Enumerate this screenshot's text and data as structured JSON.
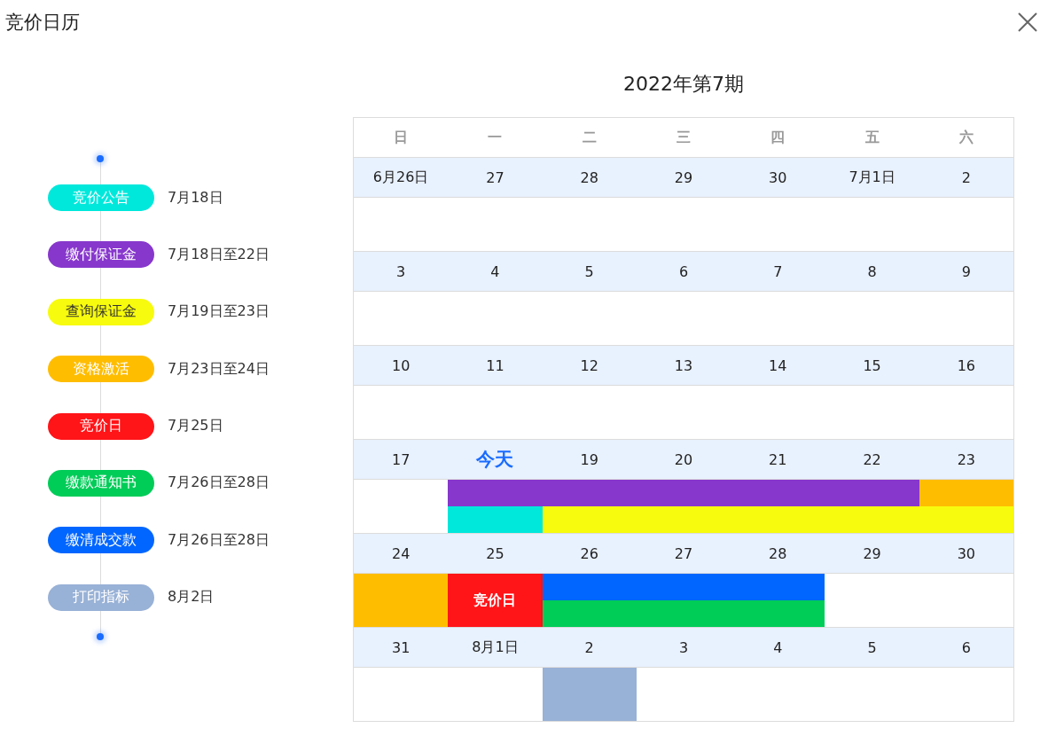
{
  "window": {
    "title": "竞价日历"
  },
  "legend": [
    {
      "label": "竞价公告",
      "color": "#00e8dc",
      "dates": "7月18日"
    },
    {
      "label": "缴付保证金",
      "color": "#8737cc",
      "dates": "7月18日至22日"
    },
    {
      "label": "查询保证金",
      "color": "#f7fb0d",
      "dates": "7月19日至23日"
    },
    {
      "label": "资格激活",
      "color": "#ffbd00",
      "dates": "7月23日至24日"
    },
    {
      "label": "竞价日",
      "color": "#ff1418",
      "dates": "7月25日"
    },
    {
      "label": "缴款通知书",
      "color": "#00cc58",
      "dates": "7月26日至28日"
    },
    {
      "label": "缴清成交款",
      "color": "#0066ff",
      "dates": "7月26日至28日"
    },
    {
      "label": "打印指标",
      "color": "#98b1d6",
      "dates": "8月2日"
    }
  ],
  "calendar": {
    "title": "2022年第7期",
    "weekdays": [
      "日",
      "一",
      "二",
      "三",
      "四",
      "五",
      "六"
    ],
    "weeks": [
      {
        "days": [
          {
            "label": "6月26日",
            "today": false
          },
          {
            "label": "27",
            "today": false
          },
          {
            "label": "28",
            "today": false
          },
          {
            "label": "29",
            "today": false
          },
          {
            "label": "30",
            "today": false
          },
          {
            "label": "7月1日",
            "today": false
          },
          {
            "label": "2",
            "today": false
          }
        ]
      },
      {
        "days": [
          {
            "label": "3",
            "today": false
          },
          {
            "label": "4",
            "today": false
          },
          {
            "label": "5",
            "today": false
          },
          {
            "label": "6",
            "today": false
          },
          {
            "label": "7",
            "today": false
          },
          {
            "label": "8",
            "today": false
          },
          {
            "label": "9",
            "today": false
          }
        ]
      },
      {
        "days": [
          {
            "label": "10",
            "today": false
          },
          {
            "label": "11",
            "today": false
          },
          {
            "label": "12",
            "today": false
          },
          {
            "label": "13",
            "today": false
          },
          {
            "label": "14",
            "today": false
          },
          {
            "label": "15",
            "today": false
          },
          {
            "label": "16",
            "today": false
          }
        ]
      },
      {
        "days": [
          {
            "label": "17",
            "today": false
          },
          {
            "label": "今天",
            "today": true,
            "top": {
              "color": "#8737cc"
            },
            "bottom": {
              "color": "#00e8dc"
            }
          },
          {
            "label": "19",
            "today": false,
            "top": {
              "color": "#8737cc"
            },
            "bottom": {
              "color": "#f7fb0d"
            }
          },
          {
            "label": "20",
            "today": false,
            "top": {
              "color": "#8737cc"
            },
            "bottom": {
              "color": "#f7fb0d"
            }
          },
          {
            "label": "21",
            "today": false,
            "top": {
              "color": "#8737cc"
            },
            "bottom": {
              "color": "#f7fb0d"
            }
          },
          {
            "label": "22",
            "today": false,
            "top": {
              "color": "#8737cc"
            },
            "bottom": {
              "color": "#f7fb0d"
            }
          },
          {
            "label": "23",
            "today": false,
            "top": {
              "color": "#ffbd00"
            },
            "bottom": {
              "color": "#f7fb0d"
            }
          }
        ]
      },
      {
        "days": [
          {
            "label": "24",
            "today": false,
            "top": {
              "color": "#ffbd00"
            },
            "bottom": {
              "color": "#ffbd00"
            }
          },
          {
            "label": "25",
            "today": false,
            "top": {
              "color": "#ff1418",
              "label": "竞价日"
            },
            "bottom": {
              "color": "#ff1418"
            }
          },
          {
            "label": "26",
            "today": false,
            "top": {
              "color": "#0066ff"
            },
            "bottom": {
              "color": "#00cc58"
            }
          },
          {
            "label": "27",
            "today": false,
            "top": {
              "color": "#0066ff"
            },
            "bottom": {
              "color": "#00cc58"
            }
          },
          {
            "label": "28",
            "today": false,
            "top": {
              "color": "#0066ff"
            },
            "bottom": {
              "color": "#00cc58"
            }
          },
          {
            "label": "29",
            "today": false
          },
          {
            "label": "30",
            "today": false
          }
        ]
      },
      {
        "days": [
          {
            "label": "31",
            "today": false
          },
          {
            "label": "8月1日",
            "today": false
          },
          {
            "label": "2",
            "today": false,
            "top": {
              "color": "#98b1d6"
            },
            "bottom": {
              "color": "#98b1d6"
            }
          },
          {
            "label": "3",
            "today": false
          },
          {
            "label": "4",
            "today": false
          },
          {
            "label": "5",
            "today": false
          },
          {
            "label": "6",
            "today": false
          }
        ]
      }
    ]
  }
}
